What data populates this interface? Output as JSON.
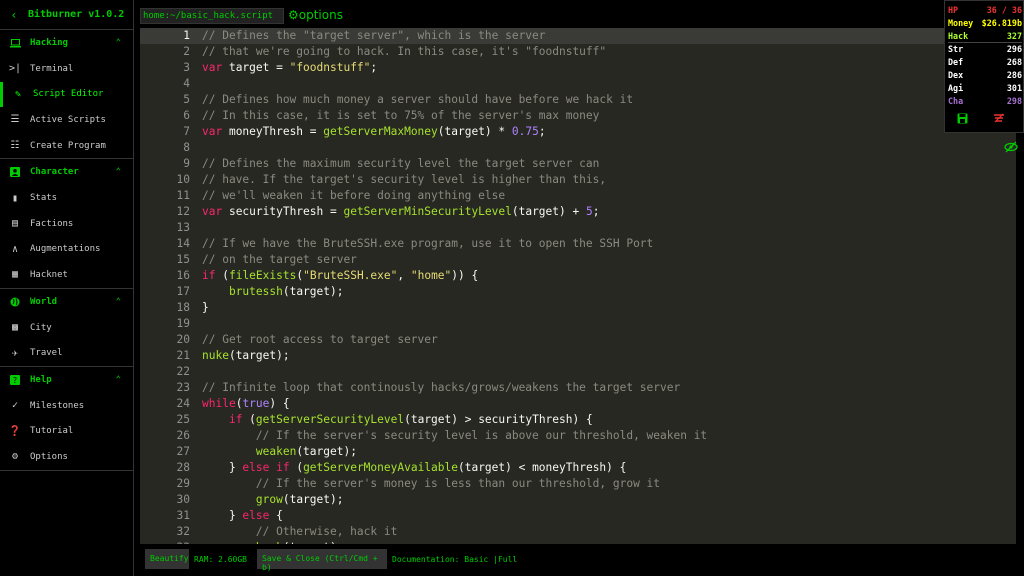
{
  "app": {
    "title": "Bitburner v1.0.2"
  },
  "sidebar": {
    "back_icon": "chevron-left-icon",
    "sections": [
      {
        "label": "Hacking",
        "icon": "laptop-icon",
        "items": [
          {
            "label": "Terminal",
            "icon": "terminal-icon",
            "active": false
          },
          {
            "label": "Script Editor",
            "icon": "pencil-icon",
            "active": true
          },
          {
            "label": "Active Scripts",
            "icon": "list-icon",
            "active": false
          },
          {
            "label": "Create Program",
            "icon": "bug-icon",
            "active": false
          }
        ]
      },
      {
        "label": "Character",
        "icon": "account-box-icon",
        "items": [
          {
            "label": "Stats",
            "icon": "bar-chart-icon"
          },
          {
            "label": "Factions",
            "icon": "contacts-icon"
          },
          {
            "label": "Augmentations",
            "icon": "double-chevron-up-icon"
          },
          {
            "label": "Hacknet",
            "icon": "account-tree-icon"
          }
        ]
      },
      {
        "label": "World",
        "icon": "globe-icon",
        "items": [
          {
            "label": "City",
            "icon": "city-icon"
          },
          {
            "label": "Travel",
            "icon": "airplane-icon"
          }
        ]
      },
      {
        "label": "Help",
        "icon": "help-box-icon",
        "items": [
          {
            "label": "Milestones",
            "icon": "check-icon"
          },
          {
            "label": "Tutorial",
            "icon": "help-circle-icon"
          },
          {
            "label": "Options",
            "icon": "gear-icon"
          }
        ]
      }
    ]
  },
  "editor": {
    "file_tab": "home:~/basic_hack.script",
    "options_label": "options",
    "current_line": 1,
    "lines": [
      [
        [
          "c",
          "// Defines the \"target server\", which is the server"
        ]
      ],
      [
        [
          "c",
          "// that we're going to hack. In this case, it's \"foodnstuff\""
        ]
      ],
      [
        [
          "k",
          "var"
        ],
        [
          "p",
          " target = "
        ],
        [
          "s",
          "\"foodnstuff\""
        ],
        [
          "p",
          ";"
        ]
      ],
      [],
      [
        [
          "c",
          "// Defines how much money a server should have before we hack it"
        ]
      ],
      [
        [
          "c",
          "// In this case, it is set to 75% of the server's max money"
        ]
      ],
      [
        [
          "k",
          "var"
        ],
        [
          "p",
          " moneyThresh = "
        ],
        [
          "fg",
          "getServerMaxMoney"
        ],
        [
          "p",
          "(target) * "
        ],
        [
          "n",
          "0.75"
        ],
        [
          "p",
          ";"
        ]
      ],
      [],
      [
        [
          "c",
          "// Defines the maximum security level the target server can"
        ]
      ],
      [
        [
          "c",
          "// have. If the target's security level is higher than this,"
        ]
      ],
      [
        [
          "c",
          "// we'll weaken it before doing anything else"
        ]
      ],
      [
        [
          "k",
          "var"
        ],
        [
          "p",
          " securityThresh = "
        ],
        [
          "fg",
          "getServerMinSecurityLevel"
        ],
        [
          "p",
          "(target) + "
        ],
        [
          "n",
          "5"
        ],
        [
          "p",
          ";"
        ]
      ],
      [],
      [
        [
          "c",
          "// If we have the BruteSSH.exe program, use it to open the SSH Port"
        ]
      ],
      [
        [
          "c",
          "// on the target server"
        ]
      ],
      [
        [
          "k",
          "if"
        ],
        [
          "p",
          " ("
        ],
        [
          "fg",
          "fileExists"
        ],
        [
          "p",
          "("
        ],
        [
          "s",
          "\"BruteSSH.exe\""
        ],
        [
          "p",
          ", "
        ],
        [
          "s",
          "\"home\""
        ],
        [
          "p",
          ")) {"
        ]
      ],
      [
        [
          "p",
          "    "
        ],
        [
          "fg",
          "brutessh"
        ],
        [
          "p",
          "(target);"
        ]
      ],
      [
        [
          "p",
          "}"
        ]
      ],
      [],
      [
        [
          "c",
          "// Get root access to target server"
        ]
      ],
      [
        [
          "fg",
          "nuke"
        ],
        [
          "p",
          "(target);"
        ]
      ],
      [],
      [
        [
          "c",
          "// Infinite loop that continously hacks/grows/weakens the target server"
        ]
      ],
      [
        [
          "k",
          "while"
        ],
        [
          "p",
          "("
        ],
        [
          "n",
          "true"
        ],
        [
          "p",
          ") {"
        ]
      ],
      [
        [
          "p",
          "    "
        ],
        [
          "k",
          "if"
        ],
        [
          "p",
          " ("
        ],
        [
          "fg",
          "getServerSecurityLevel"
        ],
        [
          "p",
          "(target) > securityThresh) {"
        ]
      ],
      [
        [
          "p",
          "        "
        ],
        [
          "c",
          "// If the server's security level is above our threshold, weaken it"
        ]
      ],
      [
        [
          "p",
          "        "
        ],
        [
          "fg",
          "weaken"
        ],
        [
          "p",
          "(target);"
        ]
      ],
      [
        [
          "p",
          "    } "
        ],
        [
          "k",
          "else if"
        ],
        [
          "p",
          " ("
        ],
        [
          "fg",
          "getServerMoneyAvailable"
        ],
        [
          "p",
          "(target) < moneyThresh) {"
        ]
      ],
      [
        [
          "p",
          "        "
        ],
        [
          "c",
          "// If the server's money is less than our threshold, grow it"
        ]
      ],
      [
        [
          "p",
          "        "
        ],
        [
          "fg",
          "grow"
        ],
        [
          "p",
          "(target);"
        ]
      ],
      [
        [
          "p",
          "    } "
        ],
        [
          "k",
          "else"
        ],
        [
          "p",
          " {"
        ]
      ],
      [
        [
          "p",
          "        "
        ],
        [
          "c",
          "// Otherwise, hack it"
        ]
      ],
      [
        [
          "p",
          "        "
        ],
        [
          "fg",
          "hack"
        ],
        [
          "p",
          "(target);"
        ]
      ]
    ]
  },
  "bottom": {
    "beautify": "Beautify",
    "ram": "RAM: 2.60GB",
    "save_close": "Save & Close (Ctrl/Cmd + b)",
    "documentation": "Documentation: Basic |Full"
  },
  "overview": {
    "rows": [
      {
        "key": "HP",
        "value": "36 / 36",
        "cls": "hp"
      },
      {
        "key": "Money",
        "value": "$26.819b",
        "cls": "money"
      },
      {
        "key": "Hack",
        "value": "327",
        "cls": "hack"
      },
      {
        "key": "Str",
        "value": "296",
        "cls": "stat"
      },
      {
        "key": "Def",
        "value": "268",
        "cls": "stat"
      },
      {
        "key": "Dex",
        "value": "286",
        "cls": "stat"
      },
      {
        "key": "Agi",
        "value": "301",
        "cls": "stat"
      },
      {
        "key": "Cha",
        "value": "298",
        "cls": "cha"
      }
    ],
    "save_icon": "save-icon",
    "kill_icon": "kill-scripts-icon",
    "visibility_icon": "eye-off-icon"
  },
  "colors": {
    "accent": "#00cc00",
    "editor_bg": "#272822",
    "comment": "#8a8a80",
    "keyword": "#f92672",
    "string": "#e6db74",
    "function": "#a6e22e",
    "number": "#ae81ff"
  }
}
